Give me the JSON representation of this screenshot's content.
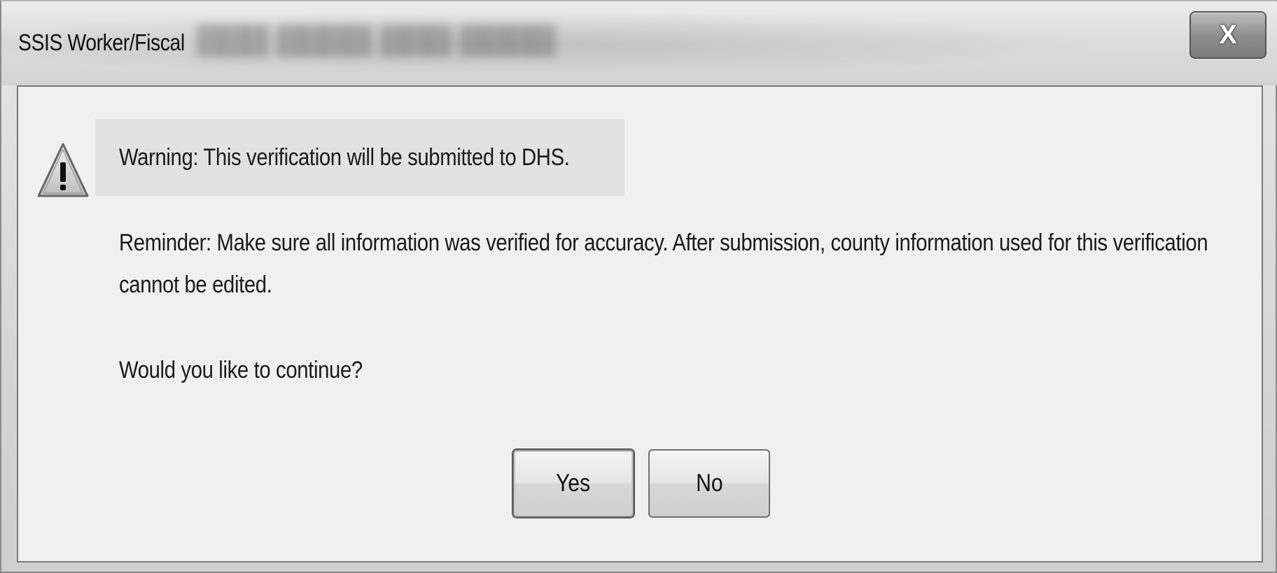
{
  "window": {
    "title": "SSIS Worker/Fiscal",
    "close_label": "X"
  },
  "dialog": {
    "warning_text": "Warning:  This verification will be submitted to DHS.",
    "reminder_line1": "Reminder:  Make sure all information was verified for accuracy.  After submission, county information used for this verification",
    "reminder_line2": "cannot be edited.",
    "question": "Would you like to continue?",
    "icon": "warning-triangle-icon"
  },
  "buttons": {
    "yes_label": "Yes",
    "no_label": "No"
  }
}
